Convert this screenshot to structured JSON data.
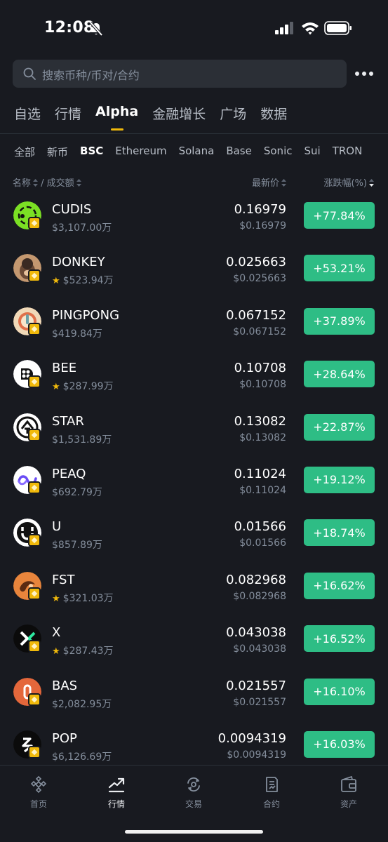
{
  "status_bar": {
    "time": "12:08"
  },
  "search": {
    "placeholder": "搜索币种/币对/合约"
  },
  "tabs": [
    {
      "label": "自选"
    },
    {
      "label": "行情"
    },
    {
      "label": "Alpha",
      "active": true
    },
    {
      "label": "金融增长"
    },
    {
      "label": "广场"
    },
    {
      "label": "数据"
    }
  ],
  "chains": [
    {
      "label": "全部"
    },
    {
      "label": "新币"
    },
    {
      "label": "BSC",
      "active": true
    },
    {
      "label": "Ethereum"
    },
    {
      "label": "Solana"
    },
    {
      "label": "Base"
    },
    {
      "label": "Sonic"
    },
    {
      "label": "Sui"
    },
    {
      "label": "TRON"
    }
  ],
  "columns": {
    "name": "名称",
    "volume": "/ 成交额",
    "price": "最新价",
    "change": "涨跌幅(%)"
  },
  "colors": {
    "up": "#2ebd85",
    "accent": "#f0b90b",
    "background": "#181a20"
  },
  "coins": [
    {
      "symbol": "CUDIS",
      "volume": "$3,107.00万",
      "starred": false,
      "price": "0.16979",
      "usd": "$0.16979",
      "change": "+77.84%",
      "icon": "cudis-icon"
    },
    {
      "symbol": "DONKEY",
      "volume": "$523.94万",
      "starred": true,
      "price": "0.025663",
      "usd": "$0.025663",
      "change": "+53.21%",
      "icon": "donkey-icon"
    },
    {
      "symbol": "PINGPONG",
      "volume": "$419.84万",
      "starred": false,
      "price": "0.067152",
      "usd": "$0.067152",
      "change": "+37.89%",
      "icon": "pingpong-icon"
    },
    {
      "symbol": "BEE",
      "volume": "$287.99万",
      "starred": true,
      "price": "0.10708",
      "usd": "$0.10708",
      "change": "+28.64%",
      "icon": "bee-icon"
    },
    {
      "symbol": "STAR",
      "volume": "$1,531.89万",
      "starred": false,
      "price": "0.13082",
      "usd": "$0.13082",
      "change": "+22.87%",
      "icon": "star-coin-icon"
    },
    {
      "symbol": "PEAQ",
      "volume": "$692.79万",
      "starred": false,
      "price": "0.11024",
      "usd": "$0.11024",
      "change": "+19.12%",
      "icon": "peaq-icon"
    },
    {
      "symbol": "U",
      "volume": "$857.89万",
      "starred": false,
      "price": "0.01566",
      "usd": "$0.01566",
      "change": "+18.74%",
      "icon": "u-coin-icon"
    },
    {
      "symbol": "FST",
      "volume": "$321.03万",
      "starred": true,
      "price": "0.082968",
      "usd": "$0.082968",
      "change": "+16.62%",
      "icon": "fst-icon"
    },
    {
      "symbol": "X",
      "volume": "$287.43万",
      "starred": true,
      "price": "0.043038",
      "usd": "$0.043038",
      "change": "+16.52%",
      "icon": "x-coin-icon"
    },
    {
      "symbol": "BAS",
      "volume": "$2,082.95万",
      "starred": false,
      "price": "0.021557",
      "usd": "$0.021557",
      "change": "+16.10%",
      "icon": "bas-icon"
    },
    {
      "symbol": "POP",
      "volume": "$6,126.69万",
      "starred": false,
      "price": "0.0094319",
      "usd": "$0.0094319",
      "change": "+16.03%",
      "icon": "pop-icon"
    }
  ],
  "bottom_nav": [
    {
      "label": "首页",
      "icon": "home-icon"
    },
    {
      "label": "行情",
      "icon": "markets-icon",
      "active": true
    },
    {
      "label": "交易",
      "icon": "trade-icon"
    },
    {
      "label": "合约",
      "icon": "futures-icon"
    },
    {
      "label": "资产",
      "icon": "wallet-icon"
    }
  ]
}
